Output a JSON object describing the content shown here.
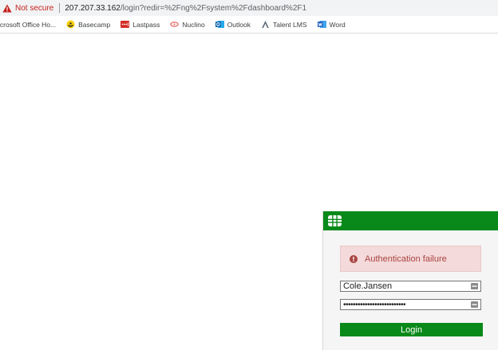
{
  "address_bar": {
    "security_label": "Not secure",
    "url_host": "207.207.33.162",
    "url_path": "/login?redir=%2Fng%2Fsystem%2Fdashboard%2F1"
  },
  "bookmarks": [
    {
      "label": "icrosoft Office Ho...",
      "icon": "microsoft-office-icon"
    },
    {
      "label": "Basecamp",
      "icon": "basecamp-icon"
    },
    {
      "label": "Lastpass",
      "icon": "lastpass-icon"
    },
    {
      "label": "Nuclino",
      "icon": "nuclino-icon"
    },
    {
      "label": "Outlook",
      "icon": "outlook-icon"
    },
    {
      "label": "Talent LMS",
      "icon": "talent-lms-icon"
    },
    {
      "label": "Word",
      "icon": "word-icon"
    }
  ],
  "login": {
    "alert_message": "Authentication failure",
    "username_value": "Cole.Jansen",
    "password_value": "••••••••••••••••••••••••••",
    "login_label": "Login"
  },
  "colors": {
    "brand_green": "#09891a",
    "alert_background": "#f4dada",
    "alert_text": "#a94442",
    "not_secure_red": "#c5221f"
  }
}
